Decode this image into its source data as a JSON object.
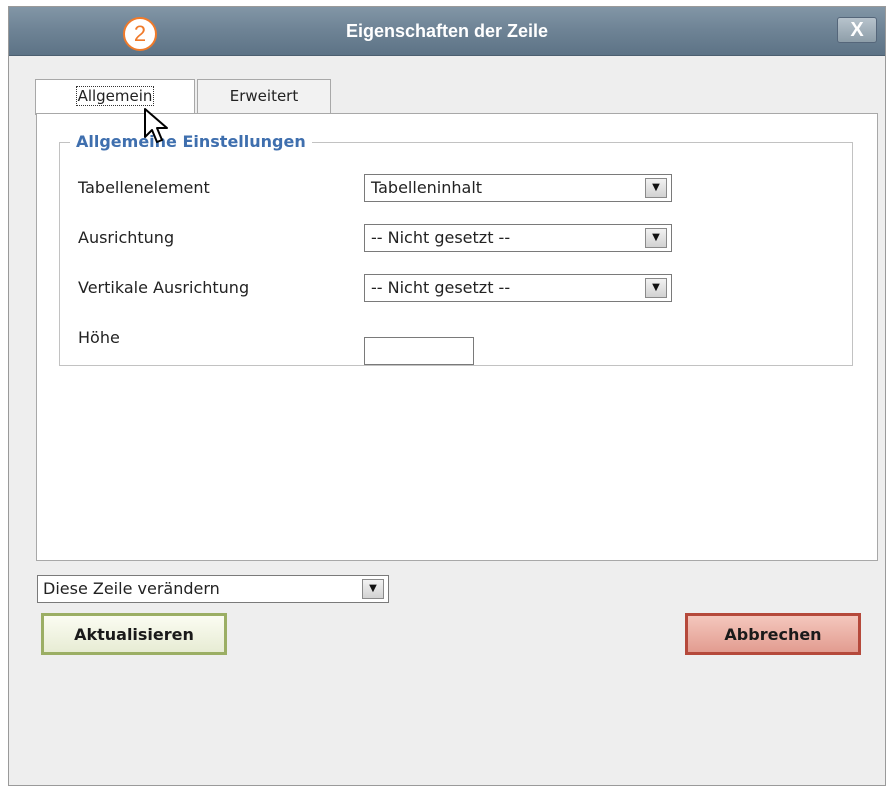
{
  "dialog": {
    "title": "Eigenschaften der Zeile",
    "close_label": "X",
    "step_badge": "2"
  },
  "tabs": [
    {
      "label": "Allgemein",
      "active": true
    },
    {
      "label": "Erweitert",
      "active": false
    }
  ],
  "general_settings": {
    "legend": "Allgemeine Einstellungen",
    "fields": [
      {
        "label": "Tabellenelement",
        "type": "select",
        "value": "Tabelleninhalt"
      },
      {
        "label": "Ausrichtung",
        "type": "select",
        "value": "-- Nicht gesetzt --"
      },
      {
        "label": "Vertikale Ausrichtung",
        "type": "select",
        "value": "-- Nicht gesetzt --"
      },
      {
        "label": "Höhe",
        "type": "text",
        "value": ""
      }
    ]
  },
  "row_action": {
    "value": "Diese Zeile verändern"
  },
  "buttons": {
    "update": "Aktualisieren",
    "cancel": "Abbrechen"
  },
  "colors": {
    "titlebar": "#6f8496",
    "legend": "#3f6fae",
    "badge": "#f07a2a",
    "update_border": "#9bae64",
    "cancel_border": "#b5493b"
  },
  "icons": [
    "close-icon",
    "chevron-down-icon",
    "mouse-cursor-icon"
  ]
}
